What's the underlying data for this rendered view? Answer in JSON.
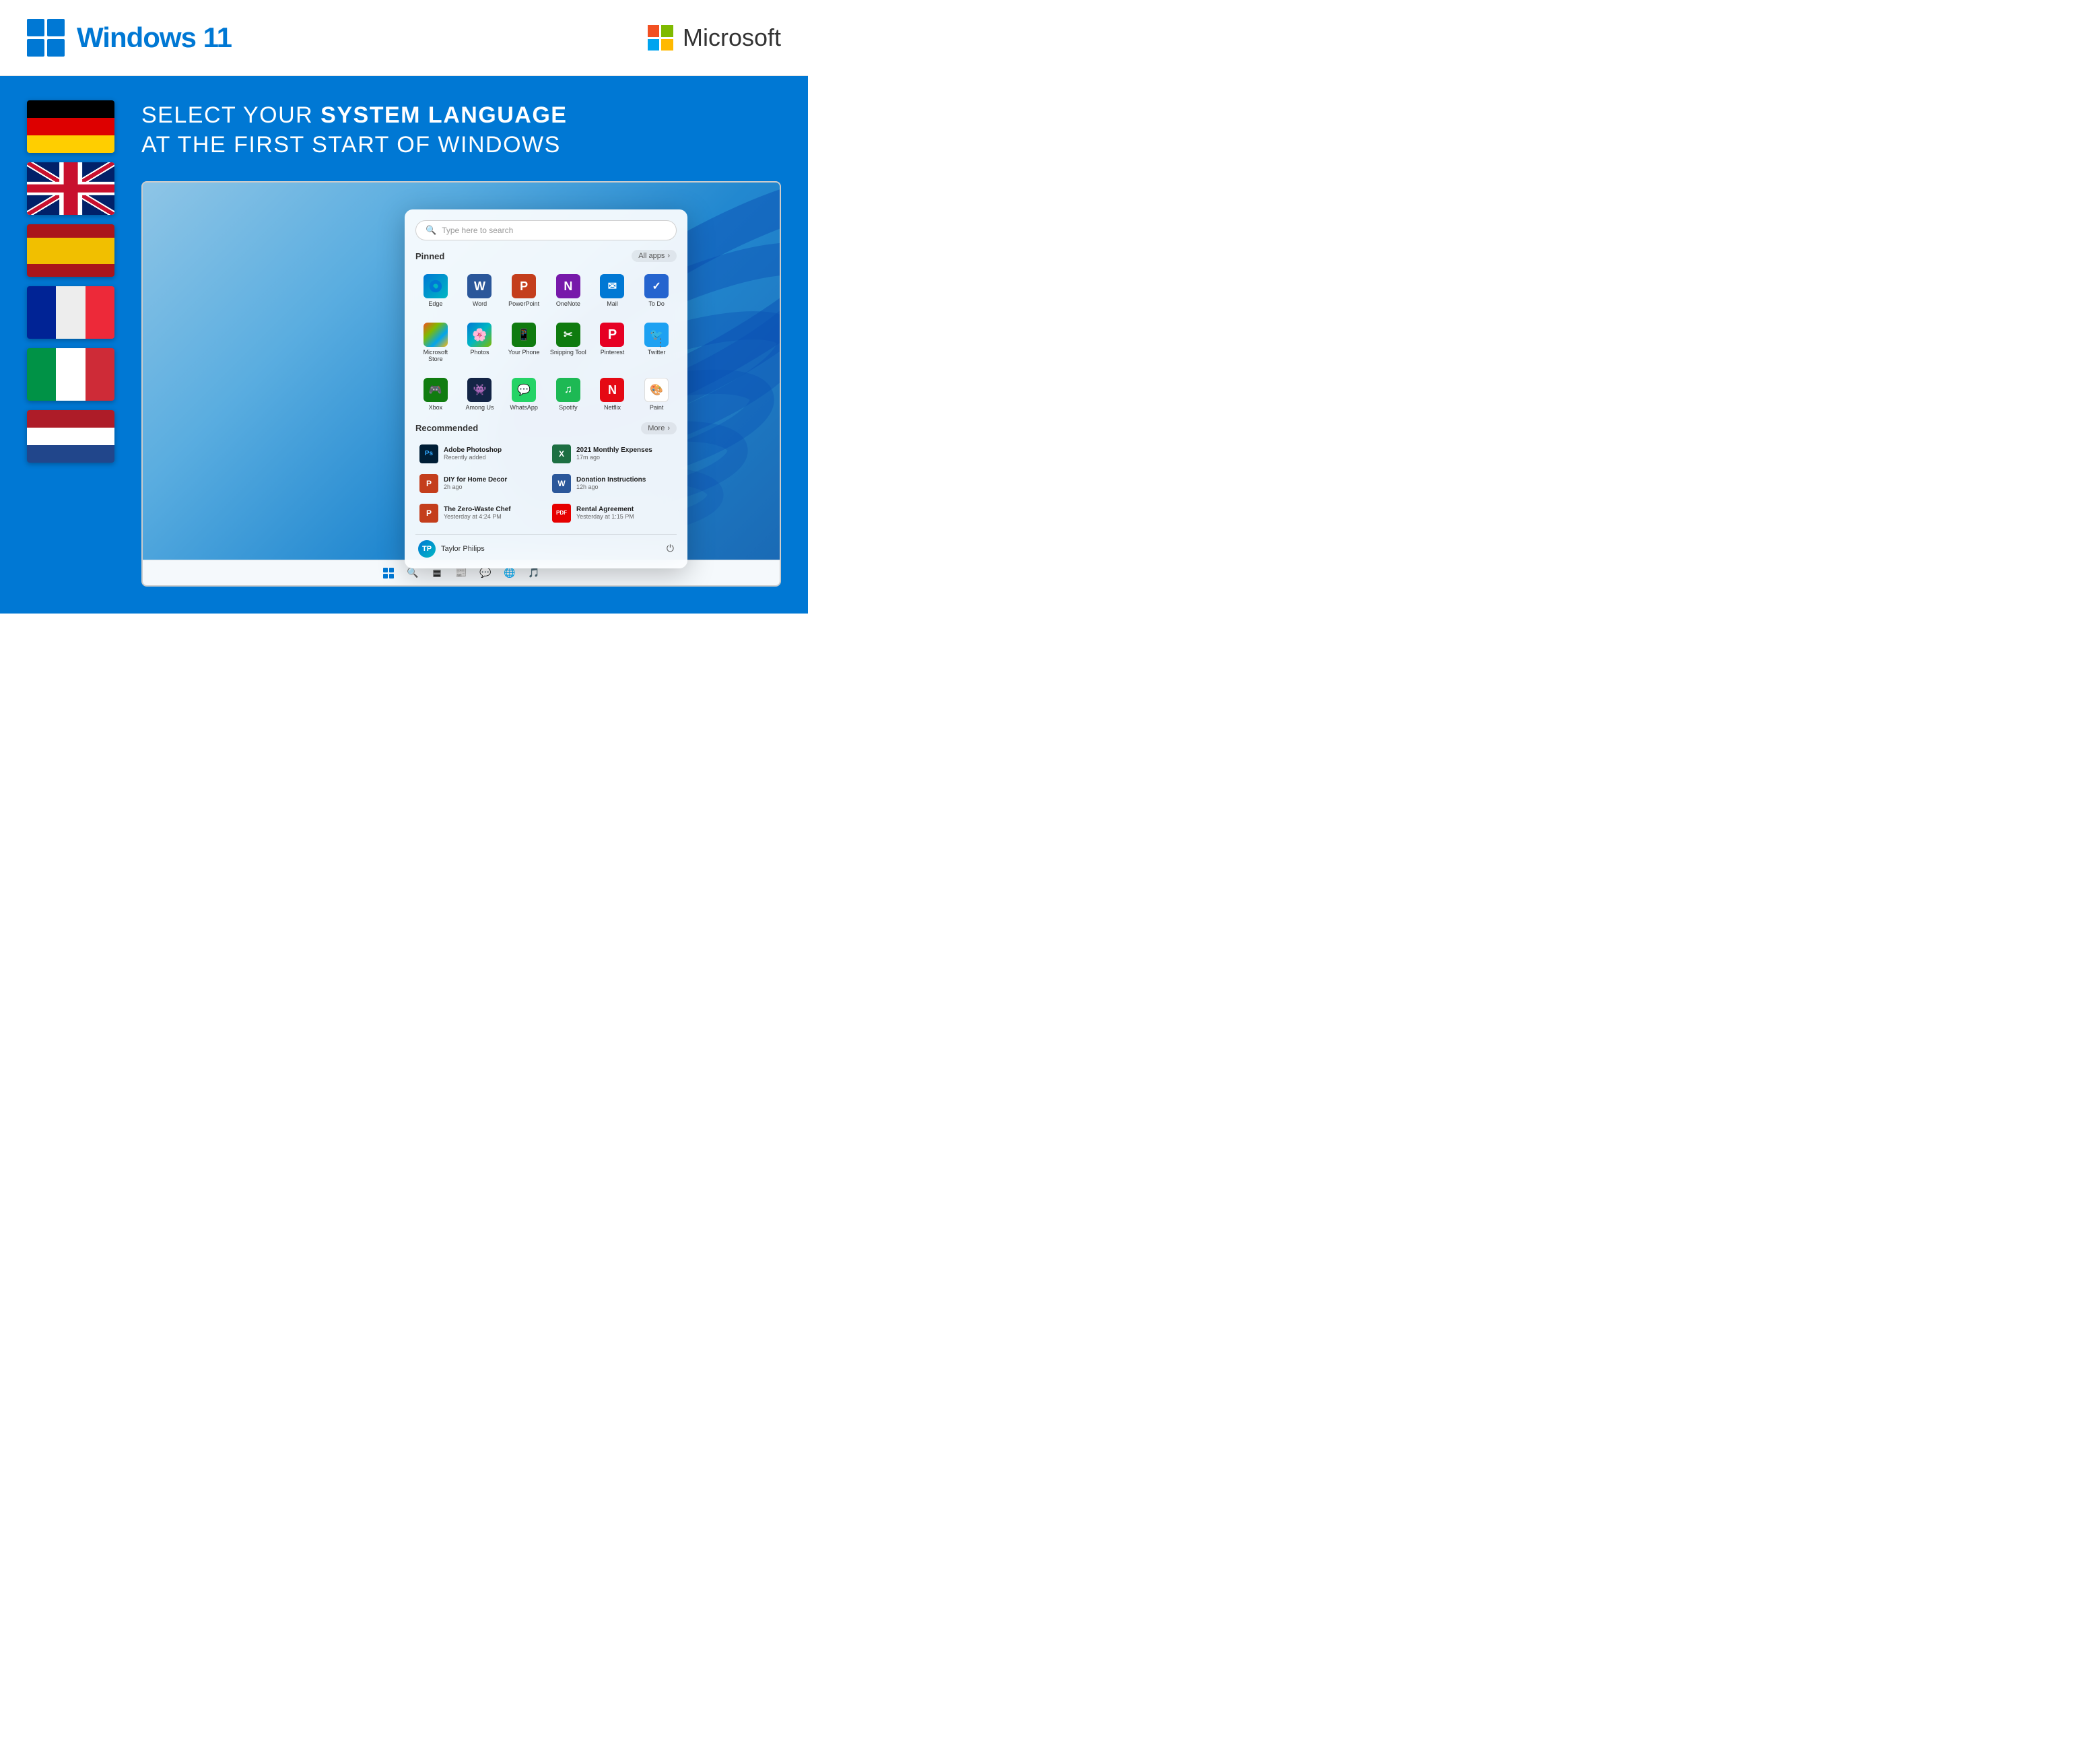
{
  "header": {
    "windows_text": "Windows ",
    "windows_number": "11",
    "microsoft_text": "Microsoft"
  },
  "headline": {
    "line1_normal": "SELECT YOUR ",
    "line1_bold": "SYSTEM LANGUAGE",
    "line2": "AT THE FIRST START OF WINDOWS"
  },
  "flags": [
    {
      "id": "de",
      "name": "Germany"
    },
    {
      "id": "uk",
      "name": "United Kingdom"
    },
    {
      "id": "es",
      "name": "Spain"
    },
    {
      "id": "fr",
      "name": "France"
    },
    {
      "id": "it",
      "name": "Italy"
    },
    {
      "id": "nl",
      "name": "Netherlands"
    }
  ],
  "start_menu": {
    "search_placeholder": "Type here to search",
    "pinned_label": "Pinned",
    "all_apps_label": "All apps",
    "more_label": "More",
    "apps": [
      {
        "id": "edge",
        "label": "Edge",
        "icon": "🌐",
        "class": "icon-edge"
      },
      {
        "id": "word",
        "label": "Word",
        "icon": "W",
        "class": "icon-word"
      },
      {
        "id": "powerpoint",
        "label": "PowerPoint",
        "icon": "P",
        "class": "icon-ppt"
      },
      {
        "id": "onenote",
        "label": "OneNote",
        "icon": "N",
        "class": "icon-onenote"
      },
      {
        "id": "mail",
        "label": "Mail",
        "icon": "✉",
        "class": "icon-mail"
      },
      {
        "id": "todo",
        "label": "To Do",
        "icon": "✓",
        "class": "icon-todo"
      },
      {
        "id": "msstore",
        "label": "Microsoft Store",
        "icon": "🏪",
        "class": "icon-msstore"
      },
      {
        "id": "photos",
        "label": "Photos",
        "icon": "🌸",
        "class": "icon-photos"
      },
      {
        "id": "yourphone",
        "label": "Your Phone",
        "icon": "📱",
        "class": "icon-yourphone"
      },
      {
        "id": "snipping",
        "label": "Snipping Tool",
        "icon": "✂",
        "class": "icon-snipping"
      },
      {
        "id": "pinterest",
        "label": "Pinterest",
        "icon": "P",
        "class": "icon-pinterest"
      },
      {
        "id": "twitter",
        "label": "Twitter",
        "icon": "🐦",
        "class": "icon-twitter"
      },
      {
        "id": "xbox",
        "label": "Xbox",
        "icon": "🎮",
        "class": "icon-xbox"
      },
      {
        "id": "among",
        "label": "Among Us",
        "icon": "👾",
        "class": "icon-among"
      },
      {
        "id": "whatsapp",
        "label": "WhatsApp",
        "icon": "💬",
        "class": "icon-whatsapp"
      },
      {
        "id": "spotify",
        "label": "Spotify",
        "icon": "♫",
        "class": "icon-spotify"
      },
      {
        "id": "netflix",
        "label": "Netflix",
        "icon": "N",
        "class": "icon-netflix"
      },
      {
        "id": "paint",
        "label": "Paint",
        "icon": "🎨",
        "class": "icon-paint"
      }
    ],
    "recommended_label": "Recommended",
    "recommended": [
      {
        "id": "photoshop",
        "name": "Adobe Photoshop",
        "sub": "Recently added",
        "icon": "Ps",
        "bg": "#001e36",
        "color": "#31a8ff"
      },
      {
        "id": "monthly",
        "name": "2021 Monthly Expenses",
        "sub": "17m ago",
        "icon": "X",
        "bg": "#1d6f42",
        "color": "#fff"
      },
      {
        "id": "diy",
        "name": "DIY for Home Decor",
        "sub": "2h ago",
        "icon": "P",
        "bg": "#c43e1c",
        "color": "#fff"
      },
      {
        "id": "donation",
        "name": "Donation Instructions",
        "sub": "12h ago",
        "icon": "W",
        "bg": "#2b579a",
        "color": "#fff"
      },
      {
        "id": "zerowaste",
        "name": "The Zero-Waste Chef",
        "sub": "Yesterday at 4:24 PM",
        "icon": "P",
        "bg": "#c43e1c",
        "color": "#fff"
      },
      {
        "id": "rental",
        "name": "Rental Agreement",
        "sub": "Yesterday at 1:15 PM",
        "icon": "PDF",
        "bg": "#e60000",
        "color": "#fff"
      }
    ],
    "user": {
      "name": "Taylor Philips",
      "initials": "TP"
    }
  },
  "taskbar": {
    "icons": [
      "⊞",
      "🔍",
      "▦",
      "💬",
      "📧",
      "🌐",
      "🎵"
    ]
  }
}
